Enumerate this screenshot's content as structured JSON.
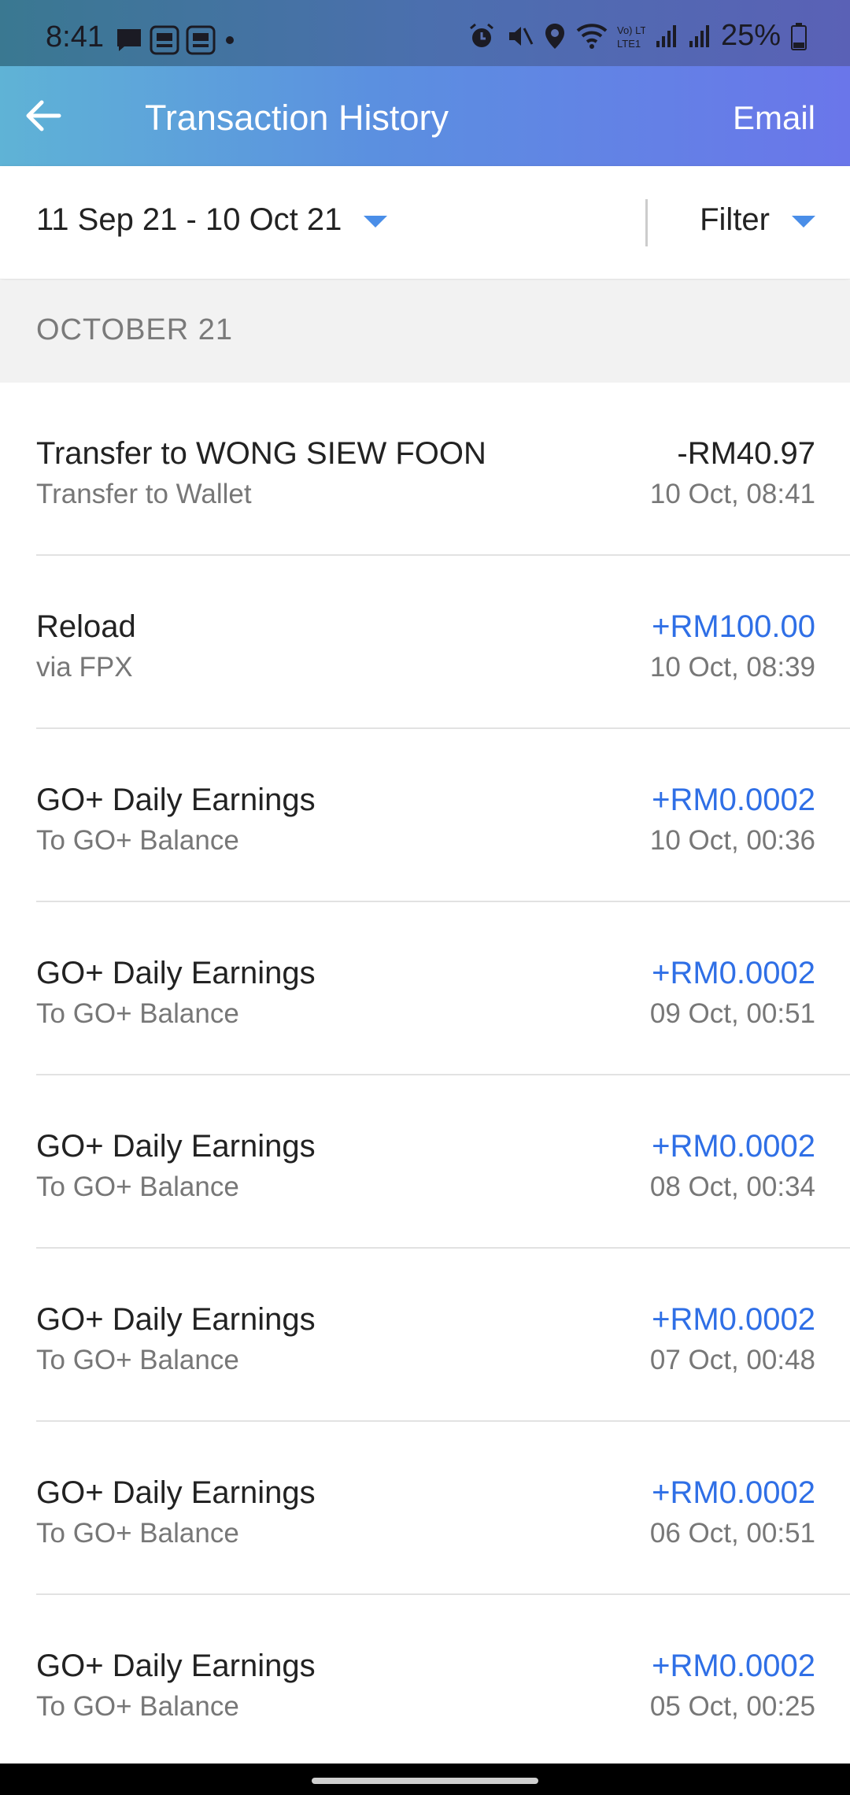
{
  "status_bar": {
    "time": "8:41",
    "battery": "25%",
    "network_label": "Vo) LTE1",
    "icons": [
      "message-icon",
      "touchngo-ewallet-icon",
      "touchngo-ewallet-icon",
      "dot-icon",
      "alarm-icon",
      "mute-icon",
      "location-icon",
      "wifi-icon",
      "signal-icon",
      "signal-icon",
      "battery-icon"
    ]
  },
  "appbar": {
    "title": "Transaction History",
    "email_label": "Email",
    "back_icon": "arrow-left-icon"
  },
  "filters": {
    "date_range": "11 Sep 21 - 10 Oct 21",
    "filter_label": "Filter",
    "accent_color": "#4a8ee8"
  },
  "section": {
    "header": "OCTOBER 21"
  },
  "colors": {
    "credit": "#2f6fe6",
    "debit": "#222222"
  },
  "transactions": [
    {
      "title": "Transfer to WONG SIEW FOON",
      "subtitle": "Transfer to Wallet",
      "amount": "-RM40.97",
      "date": "10 Oct, 08:41",
      "type": "debit"
    },
    {
      "title": "Reload",
      "subtitle": "via FPX",
      "amount": "+RM100.00",
      "date": "10 Oct, 08:39",
      "type": "credit"
    },
    {
      "title": "GO+ Daily Earnings",
      "subtitle": "To GO+ Balance",
      "amount": "+RM0.0002",
      "date": "10 Oct, 00:36",
      "type": "credit"
    },
    {
      "title": "GO+ Daily Earnings",
      "subtitle": "To GO+ Balance",
      "amount": "+RM0.0002",
      "date": "09 Oct, 00:51",
      "type": "credit"
    },
    {
      "title": "GO+ Daily Earnings",
      "subtitle": "To GO+ Balance",
      "amount": "+RM0.0002",
      "date": "08 Oct, 00:34",
      "type": "credit"
    },
    {
      "title": "GO+ Daily Earnings",
      "subtitle": "To GO+ Balance",
      "amount": "+RM0.0002",
      "date": "07 Oct, 00:48",
      "type": "credit"
    },
    {
      "title": "GO+ Daily Earnings",
      "subtitle": "To GO+ Balance",
      "amount": "+RM0.0002",
      "date": "06 Oct, 00:51",
      "type": "credit"
    },
    {
      "title": "GO+ Daily Earnings",
      "subtitle": "To GO+ Balance",
      "amount": "+RM0.0002",
      "date": "05 Oct, 00:25",
      "type": "credit"
    }
  ]
}
